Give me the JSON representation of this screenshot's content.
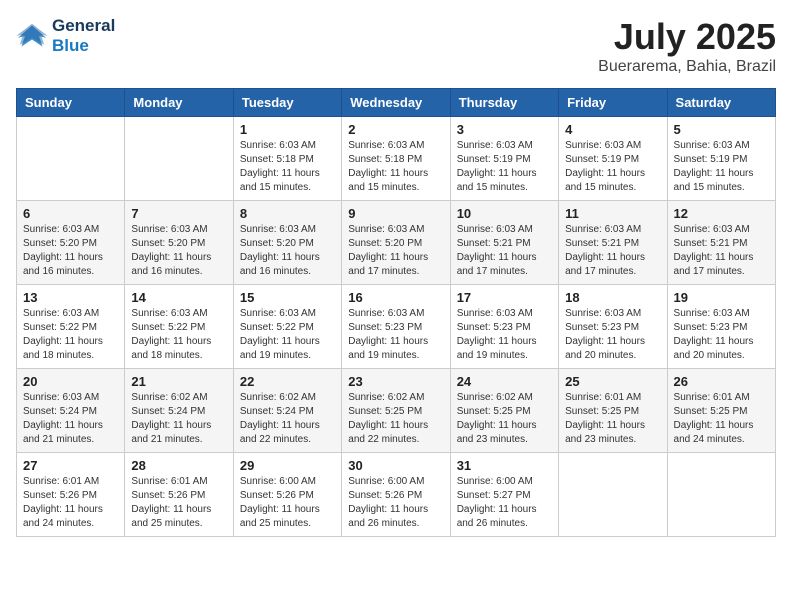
{
  "header": {
    "logo_line1": "General",
    "logo_line2": "Blue",
    "title": "July 2025",
    "subtitle": "Buerarema, Bahia, Brazil"
  },
  "weekdays": [
    "Sunday",
    "Monday",
    "Tuesday",
    "Wednesday",
    "Thursday",
    "Friday",
    "Saturday"
  ],
  "weeks": [
    [
      {
        "day": "",
        "sunrise": "",
        "sunset": "",
        "daylight": ""
      },
      {
        "day": "",
        "sunrise": "",
        "sunset": "",
        "daylight": ""
      },
      {
        "day": "1",
        "sunrise": "Sunrise: 6:03 AM",
        "sunset": "Sunset: 5:18 PM",
        "daylight": "Daylight: 11 hours and 15 minutes."
      },
      {
        "day": "2",
        "sunrise": "Sunrise: 6:03 AM",
        "sunset": "Sunset: 5:18 PM",
        "daylight": "Daylight: 11 hours and 15 minutes."
      },
      {
        "day": "3",
        "sunrise": "Sunrise: 6:03 AM",
        "sunset": "Sunset: 5:19 PM",
        "daylight": "Daylight: 11 hours and 15 minutes."
      },
      {
        "day": "4",
        "sunrise": "Sunrise: 6:03 AM",
        "sunset": "Sunset: 5:19 PM",
        "daylight": "Daylight: 11 hours and 15 minutes."
      },
      {
        "day": "5",
        "sunrise": "Sunrise: 6:03 AM",
        "sunset": "Sunset: 5:19 PM",
        "daylight": "Daylight: 11 hours and 15 minutes."
      }
    ],
    [
      {
        "day": "6",
        "sunrise": "Sunrise: 6:03 AM",
        "sunset": "Sunset: 5:20 PM",
        "daylight": "Daylight: 11 hours and 16 minutes."
      },
      {
        "day": "7",
        "sunrise": "Sunrise: 6:03 AM",
        "sunset": "Sunset: 5:20 PM",
        "daylight": "Daylight: 11 hours and 16 minutes."
      },
      {
        "day": "8",
        "sunrise": "Sunrise: 6:03 AM",
        "sunset": "Sunset: 5:20 PM",
        "daylight": "Daylight: 11 hours and 16 minutes."
      },
      {
        "day": "9",
        "sunrise": "Sunrise: 6:03 AM",
        "sunset": "Sunset: 5:20 PM",
        "daylight": "Daylight: 11 hours and 17 minutes."
      },
      {
        "day": "10",
        "sunrise": "Sunrise: 6:03 AM",
        "sunset": "Sunset: 5:21 PM",
        "daylight": "Daylight: 11 hours and 17 minutes."
      },
      {
        "day": "11",
        "sunrise": "Sunrise: 6:03 AM",
        "sunset": "Sunset: 5:21 PM",
        "daylight": "Daylight: 11 hours and 17 minutes."
      },
      {
        "day": "12",
        "sunrise": "Sunrise: 6:03 AM",
        "sunset": "Sunset: 5:21 PM",
        "daylight": "Daylight: 11 hours and 17 minutes."
      }
    ],
    [
      {
        "day": "13",
        "sunrise": "Sunrise: 6:03 AM",
        "sunset": "Sunset: 5:22 PM",
        "daylight": "Daylight: 11 hours and 18 minutes."
      },
      {
        "day": "14",
        "sunrise": "Sunrise: 6:03 AM",
        "sunset": "Sunset: 5:22 PM",
        "daylight": "Daylight: 11 hours and 18 minutes."
      },
      {
        "day": "15",
        "sunrise": "Sunrise: 6:03 AM",
        "sunset": "Sunset: 5:22 PM",
        "daylight": "Daylight: 11 hours and 19 minutes."
      },
      {
        "day": "16",
        "sunrise": "Sunrise: 6:03 AM",
        "sunset": "Sunset: 5:23 PM",
        "daylight": "Daylight: 11 hours and 19 minutes."
      },
      {
        "day": "17",
        "sunrise": "Sunrise: 6:03 AM",
        "sunset": "Sunset: 5:23 PM",
        "daylight": "Daylight: 11 hours and 19 minutes."
      },
      {
        "day": "18",
        "sunrise": "Sunrise: 6:03 AM",
        "sunset": "Sunset: 5:23 PM",
        "daylight": "Daylight: 11 hours and 20 minutes."
      },
      {
        "day": "19",
        "sunrise": "Sunrise: 6:03 AM",
        "sunset": "Sunset: 5:23 PM",
        "daylight": "Daylight: 11 hours and 20 minutes."
      }
    ],
    [
      {
        "day": "20",
        "sunrise": "Sunrise: 6:03 AM",
        "sunset": "Sunset: 5:24 PM",
        "daylight": "Daylight: 11 hours and 21 minutes."
      },
      {
        "day": "21",
        "sunrise": "Sunrise: 6:02 AM",
        "sunset": "Sunset: 5:24 PM",
        "daylight": "Daylight: 11 hours and 21 minutes."
      },
      {
        "day": "22",
        "sunrise": "Sunrise: 6:02 AM",
        "sunset": "Sunset: 5:24 PM",
        "daylight": "Daylight: 11 hours and 22 minutes."
      },
      {
        "day": "23",
        "sunrise": "Sunrise: 6:02 AM",
        "sunset": "Sunset: 5:25 PM",
        "daylight": "Daylight: 11 hours and 22 minutes."
      },
      {
        "day": "24",
        "sunrise": "Sunrise: 6:02 AM",
        "sunset": "Sunset: 5:25 PM",
        "daylight": "Daylight: 11 hours and 23 minutes."
      },
      {
        "day": "25",
        "sunrise": "Sunrise: 6:01 AM",
        "sunset": "Sunset: 5:25 PM",
        "daylight": "Daylight: 11 hours and 23 minutes."
      },
      {
        "day": "26",
        "sunrise": "Sunrise: 6:01 AM",
        "sunset": "Sunset: 5:25 PM",
        "daylight": "Daylight: 11 hours and 24 minutes."
      }
    ],
    [
      {
        "day": "27",
        "sunrise": "Sunrise: 6:01 AM",
        "sunset": "Sunset: 5:26 PM",
        "daylight": "Daylight: 11 hours and 24 minutes."
      },
      {
        "day": "28",
        "sunrise": "Sunrise: 6:01 AM",
        "sunset": "Sunset: 5:26 PM",
        "daylight": "Daylight: 11 hours and 25 minutes."
      },
      {
        "day": "29",
        "sunrise": "Sunrise: 6:00 AM",
        "sunset": "Sunset: 5:26 PM",
        "daylight": "Daylight: 11 hours and 25 minutes."
      },
      {
        "day": "30",
        "sunrise": "Sunrise: 6:00 AM",
        "sunset": "Sunset: 5:26 PM",
        "daylight": "Daylight: 11 hours and 26 minutes."
      },
      {
        "day": "31",
        "sunrise": "Sunrise: 6:00 AM",
        "sunset": "Sunset: 5:27 PM",
        "daylight": "Daylight: 11 hours and 26 minutes."
      },
      {
        "day": "",
        "sunrise": "",
        "sunset": "",
        "daylight": ""
      },
      {
        "day": "",
        "sunrise": "",
        "sunset": "",
        "daylight": ""
      }
    ]
  ]
}
